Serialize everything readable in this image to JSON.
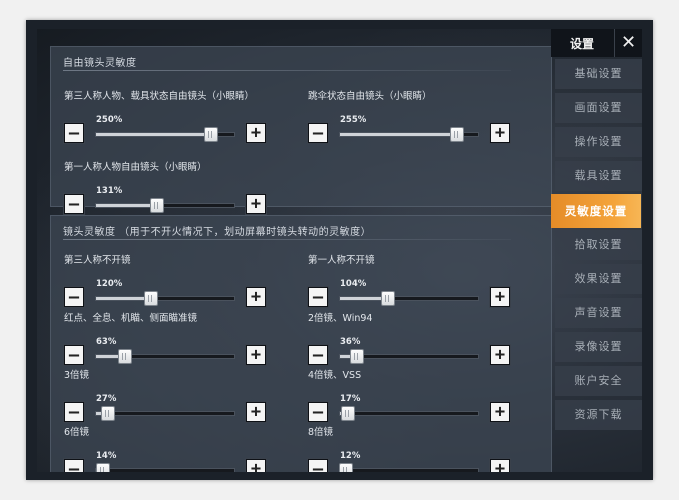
{
  "sidebar": {
    "title": "设置",
    "close_icon": "close-icon",
    "items": [
      {
        "label": "基础设置",
        "active": false
      },
      {
        "label": "画面设置",
        "active": false
      },
      {
        "label": "操作设置",
        "active": false
      },
      {
        "label": "载具设置",
        "active": false
      },
      {
        "label": "灵敏度设置",
        "active": true
      },
      {
        "label": "拾取设置",
        "active": false
      },
      {
        "label": "效果设置",
        "active": false
      },
      {
        "label": "声音设置",
        "active": false
      },
      {
        "label": "录像设置",
        "active": false
      },
      {
        "label": "账户安全",
        "active": false
      },
      {
        "label": "资源下载",
        "active": false
      }
    ]
  },
  "free_camera": {
    "title": "自由镜头灵敏度",
    "sliders": [
      {
        "label": "第三人称人物、载具状态自由镜头（小眼睛）",
        "value": "250%",
        "fraction": 0.83
      },
      {
        "label": "跳伞状态自由镜头（小眼睛）",
        "value": "255%",
        "fraction": 0.85
      },
      {
        "label": "第一人称人物自由镜头（小眼睛）",
        "value": "131%",
        "fraction": 0.44
      }
    ]
  },
  "camera": {
    "title": "镜头灵敏度 （用于不开火情况下，划动屏幕时镜头转动的灵敏度）",
    "sliders": [
      {
        "label": "第三人称不开镜",
        "value": "120%",
        "fraction": 0.4
      },
      {
        "label": "第一人称不开镜",
        "value": "104%",
        "fraction": 0.35
      },
      {
        "label": "红点、全息、机瞄、侧面瞄准镜",
        "value": "63%",
        "fraction": 0.21
      },
      {
        "label": "2倍镜、Win94",
        "value": "36%",
        "fraction": 0.12
      },
      {
        "label": "3倍镜",
        "value": "27%",
        "fraction": 0.09
      },
      {
        "label": "4倍镜、VSS",
        "value": "17%",
        "fraction": 0.06
      },
      {
        "label": "6倍镜",
        "value": "14%",
        "fraction": 0.05
      },
      {
        "label": "8倍镜",
        "value": "12%",
        "fraction": 0.04
      }
    ]
  },
  "controls": {
    "minus": "—",
    "plus": "+"
  },
  "colors": {
    "accent": "#f0a03a",
    "panel": "#3e4856",
    "button": "#f4f4f4"
  }
}
